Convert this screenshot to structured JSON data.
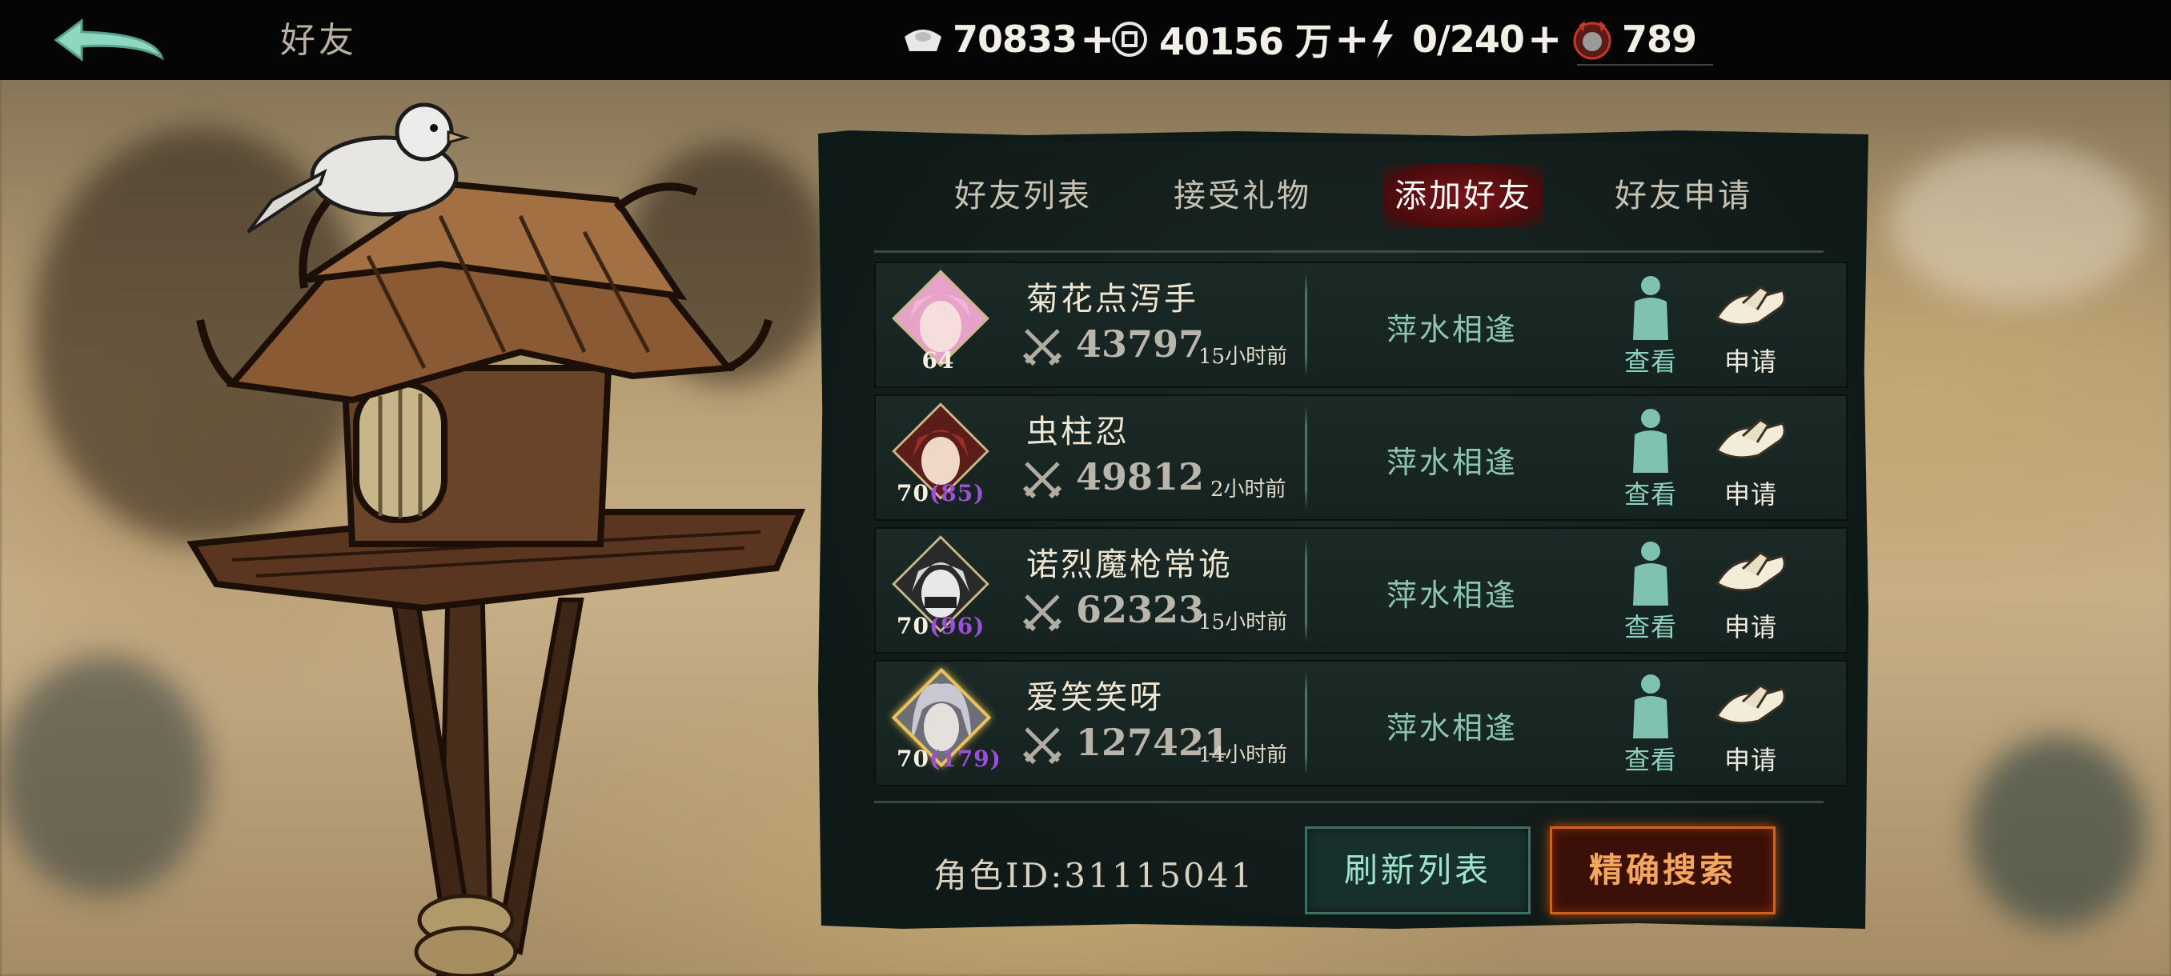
{
  "header": {
    "title": "好友",
    "back_icon": "back-arrow-icon",
    "resources": [
      {
        "icon": "silver-ingot-icon",
        "value": "70833",
        "plus": "+"
      },
      {
        "icon": "copper-coin-icon",
        "value": "40156 万",
        "plus": "+"
      },
      {
        "icon": "lightning-icon",
        "value": "0/240",
        "plus": "+"
      },
      {
        "icon": "demon-mask-icon",
        "value": "789"
      }
    ]
  },
  "tabs": [
    {
      "label": "好友列表",
      "active": false
    },
    {
      "label": "接受礼物",
      "active": false
    },
    {
      "label": "添加好友",
      "active": true
    },
    {
      "label": "好友申请",
      "active": false
    }
  ],
  "players": [
    {
      "name": "菊花点泻手",
      "level": "64",
      "level_extra": "",
      "power": "43797",
      "time_ago": "15小时前",
      "status": "萍水相逢",
      "view_label": "查看",
      "apply_label": "申请",
      "avatar_color": "#e7a2c8",
      "hair_color": "#f0b6d6",
      "gold_frame": false
    },
    {
      "name": "虫柱忍",
      "level": "70",
      "level_extra": "(85)",
      "power": "49812",
      "time_ago": "2小时前",
      "status": "萍水相逢",
      "view_label": "查看",
      "apply_label": "申请",
      "avatar_color": "#7a2a24",
      "hair_color": "#9c2f24",
      "gold_frame": false
    },
    {
      "name": "诺烈魔枪常诡",
      "level": "70",
      "level_extra": "(96)",
      "power": "62323",
      "time_ago": "15小时前",
      "status": "萍水相逢",
      "view_label": "查看",
      "apply_label": "申请",
      "avatar_color": "#3a3a3a",
      "hair_color": "#d8d8d8",
      "gold_frame": false
    },
    {
      "name": "爱笑笑呀",
      "level": "70",
      "level_extra": "(179)",
      "power": "127421",
      "time_ago": "14小时前",
      "status": "萍水相逢",
      "view_label": "查看",
      "apply_label": "申请",
      "avatar_color": "#8a8a96",
      "hair_color": "#c8c8d2",
      "gold_frame": true
    }
  ],
  "footer": {
    "role_id": "角色ID:31115041",
    "refresh_label": "刷新列表",
    "search_label": "精确搜索"
  },
  "colors": {
    "active_tab": "#5a0f10",
    "status_text": "#8ec4b2",
    "refresh_accent": "#3f6e62",
    "search_accent": "#d0601a"
  }
}
